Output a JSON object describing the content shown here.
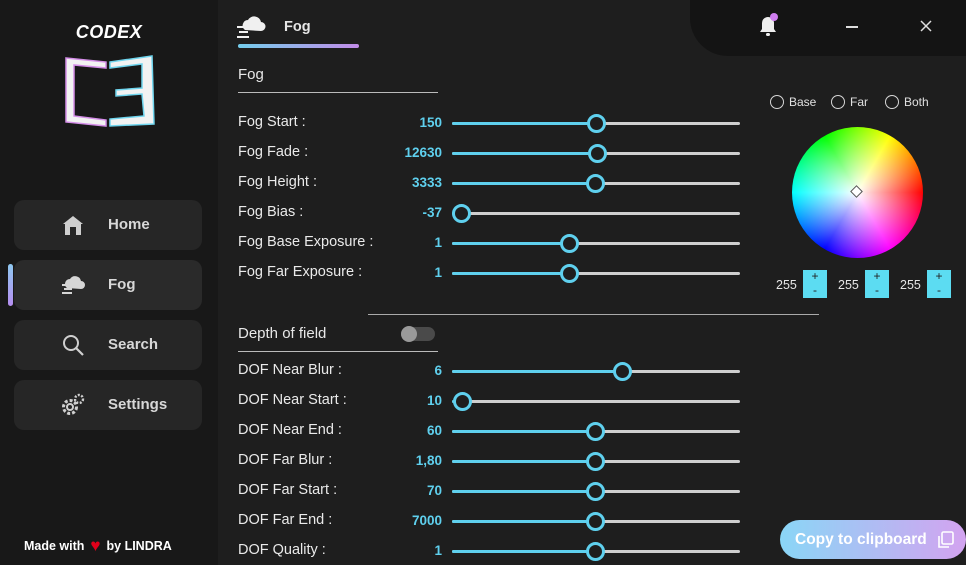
{
  "brand": "CODEX",
  "nav": [
    {
      "label": "Home",
      "icon": "house-icon"
    },
    {
      "label": "Fog",
      "icon": "fog-cloud-icon"
    },
    {
      "label": "Search",
      "icon": "search-icon"
    },
    {
      "label": "Settings",
      "icon": "gears-icon"
    }
  ],
  "footer": {
    "made_with": "Made with",
    "by": "by LINDRA"
  },
  "header": {
    "tab_label": "Fog"
  },
  "fog": {
    "title": "Fog",
    "rows": [
      {
        "label": "Fog Start :",
        "value": "150",
        "level": 0.5
      },
      {
        "label": "Fog Fade :",
        "value": "12630",
        "level": 0.505
      },
      {
        "label": "Fog Height :",
        "value": "3333",
        "level": 0.495
      },
      {
        "label": "Fog Bias :",
        "value": "-37",
        "level": 0.03
      },
      {
        "label": "Fog Base Exposure :",
        "value": "1",
        "level": 0.405
      },
      {
        "label": "Fog Far Exposure :",
        "value": "1",
        "level": 0.405
      }
    ]
  },
  "dof": {
    "title": "Depth of field",
    "enabled": false,
    "rows": [
      {
        "label": "DOF Near Blur :",
        "value": "6",
        "level": 0.59
      },
      {
        "label": "DOF Near Start :",
        "value": "10",
        "level": 0.035
      },
      {
        "label": "DOF Near End :",
        "value": "60",
        "level": 0.495
      },
      {
        "label": "DOF Far Blur :",
        "value": "1,80",
        "level": 0.495
      },
      {
        "label": "DOF Far Start :",
        "value": "70",
        "level": 0.495
      },
      {
        "label": "DOF Far End :",
        "value": "7000",
        "level": 0.495
      },
      {
        "label": "DOF Quality :",
        "value": "1",
        "level": 0.495
      }
    ]
  },
  "color_picker": {
    "modes": [
      "Base",
      "Far",
      "Both"
    ],
    "rgb": [
      "255",
      "255",
      "255"
    ],
    "plus": "+",
    "minus": "-"
  },
  "copy_button": {
    "label": "Copy to clipboard"
  },
  "colors": {
    "accent": "#5fd0ee",
    "gradient_start": "#8ad6f6",
    "gradient_end": "#d3a3f0",
    "notification_dot": "#d07ef0",
    "heart": "#e0001a"
  }
}
